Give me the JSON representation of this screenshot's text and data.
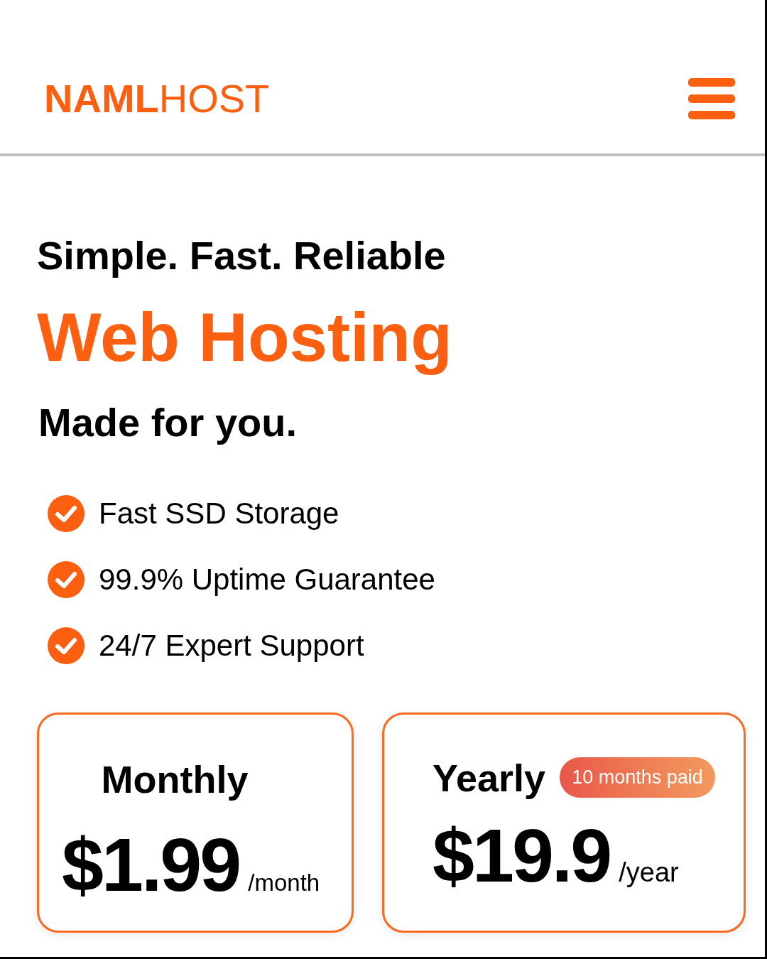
{
  "header": {
    "logo": "**NAML**HOST"
  },
  "hero": {
    "tagline": "Simple. Fast. Reliable",
    "title": "Web Hosting",
    "subtitle": "Made for you."
  },
  "features": [
    {
      "label": "Fast SSD Storage"
    },
    {
      "label": "99.9% Uptime Guarantee"
    },
    {
      "label": "24/7 Expert Support"
    }
  ],
  "plans": [
    {
      "name": "Monthly",
      "price": "$1.99",
      "period": "/month"
    },
    {
      "name": "Yearly",
      "badge": "10 months paid",
      "price": "$19.9",
      "period": "/year"
    }
  ]
}
